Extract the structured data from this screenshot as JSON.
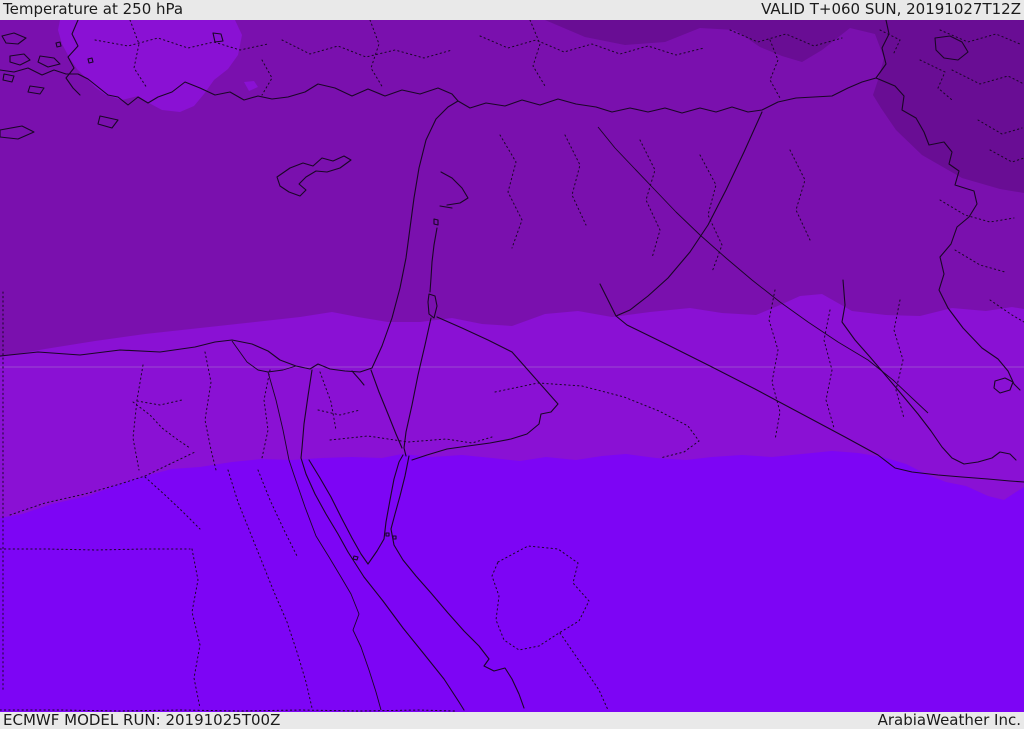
{
  "header": {
    "title": "Temperature at 250 hPa",
    "valid": "VALID T+060 SUN, 20191027T12Z"
  },
  "footer": {
    "model_run": "ECMWF MODEL RUN: 20191025T00Z",
    "credit": "ArabiaWeather Inc."
  },
  "map": {
    "colors": {
      "chrome_bg": "#e9e9e9",
      "text": "#1b1b1b",
      "band_base": "#7a10ae",
      "band_dark": "#690d94",
      "band_bright": "#8a11d4",
      "band_violet": "#7d05f5",
      "line": "#1a0626",
      "grid": "#a678cf"
    },
    "bands": [
      {
        "name": "darkest-purple-north",
        "color": "#690d94"
      },
      {
        "name": "base-purple",
        "color": "#7a10ae"
      },
      {
        "name": "bright-purple-mid",
        "color": "#8a11d4"
      },
      {
        "name": "violet-south",
        "color": "#7d05f5"
      }
    ]
  }
}
